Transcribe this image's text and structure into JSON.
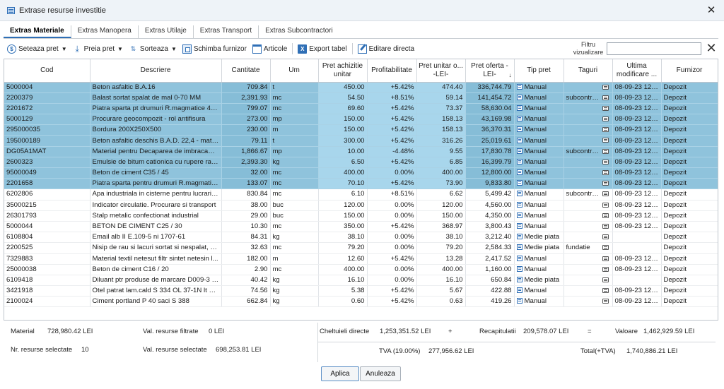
{
  "window": {
    "title": "Extrase resurse investitie",
    "close_glyph": "✕"
  },
  "tabs": [
    {
      "label": "Extras Materiale",
      "active": true
    },
    {
      "label": "Extras Manopera",
      "active": false
    },
    {
      "label": "Extras Utilaje",
      "active": false
    },
    {
      "label": "Extras Transport",
      "active": false
    },
    {
      "label": "Extras Subcontractori",
      "active": false
    }
  ],
  "toolbar": {
    "seteaza_pret": "Seteaza pret",
    "preia_pret": "Preia pret",
    "sorteaza": "Sorteaza",
    "schimba_furnizor": "Schimba furnizor",
    "articole": "Articole",
    "export_tabel": "Export tabel",
    "editare_directa": "Editare directa",
    "caret": "▼"
  },
  "filter": {
    "label": "Filtru vizualizare",
    "value": "",
    "clear_glyph": "✕"
  },
  "columns": [
    "Cod",
    "Descriere",
    "Cantitate",
    "Um",
    "Pret achizitie unitar",
    "Profitabilitate",
    "Pret unitar o... -LEI-",
    "Pret oferta -LEI-",
    "Tip pret",
    "Taguri",
    "Ultima modificare ...",
    "Furnizor"
  ],
  "rows": [
    {
      "cod": "5000004",
      "descriere": "Beton asfaltic B.A.16",
      "cantitate": "709.84",
      "um": "t",
      "pret_achizitie": "450.00",
      "profit": "+5.42%",
      "pret_unitar": "474.40",
      "pret_oferta": "336,744.79",
      "tip": "Manual",
      "taguri": "",
      "note": true,
      "modificare": "08-09-23 12:4...",
      "furnizor": "Depozit",
      "selected": true
    },
    {
      "cod": "2200379",
      "descriere": "Balast sortat spalat de mal 0-70 MM",
      "cantitate": "2,391.93",
      "um": "mc",
      "pret_achizitie": "54.50",
      "profit": "+8.51%",
      "pret_unitar": "59.14",
      "pret_oferta": "141,454.72",
      "tip": "Manual",
      "taguri": "subcontrac...",
      "note": true,
      "modificare": "08-09-23 12:4...",
      "furnizor": "Depozit",
      "selected": true
    },
    {
      "cod": "2201672",
      "descriere": "Piatra sparta pt drumuri R.magmatice 40-...",
      "cantitate": "799.07",
      "um": "mc",
      "pret_achizitie": "69.60",
      "profit": "+5.42%",
      "pret_unitar": "73.37",
      "pret_oferta": "58,630.04",
      "tip": "Manual",
      "taguri": "",
      "note": true,
      "modificare": "08-09-23 12:4...",
      "furnizor": "Depozit",
      "selected": true
    },
    {
      "cod": "5000129",
      "descriere": "Procurare geocompozit - rol antifisura",
      "cantitate": "273.00",
      "um": "mp",
      "pret_achizitie": "150.00",
      "profit": "+5.42%",
      "pret_unitar": "158.13",
      "pret_oferta": "43,169.98",
      "tip": "Manual",
      "taguri": "",
      "note": true,
      "modificare": "08-09-23 12:4...",
      "furnizor": "Depozit",
      "selected": true
    },
    {
      "cod": "295000035",
      "descriere": "Bordura 200X250X500",
      "cantitate": "230.00",
      "um": "m",
      "pret_achizitie": "150.00",
      "profit": "+5.42%",
      "pret_unitar": "158.13",
      "pret_oferta": "36,370.31",
      "tip": "Manual",
      "taguri": "",
      "note": true,
      "modificare": "08-09-23 12:4...",
      "furnizor": "Depozit",
      "selected": true
    },
    {
      "cod": "195000189",
      "descriere": "Beton asfaltic deschis B.A.D. 22,4 - material",
      "cantitate": "79.11",
      "um": "t",
      "pret_achizitie": "300.00",
      "profit": "+5.42%",
      "pret_unitar": "316.26",
      "pret_oferta": "25,019.61",
      "tip": "Manual",
      "taguri": "",
      "note": true,
      "modificare": "08-09-23 12:4...",
      "furnizor": "Depozit",
      "selected": true
    },
    {
      "cod": "DG05A1MAT",
      "descriere": "Material pentru Decaparea de imbracami...",
      "cantitate": "1,866.67",
      "um": "mp",
      "pret_achizitie": "10.00",
      "profit": "-4.48%",
      "pret_unitar": "9.55",
      "pret_oferta": "17,830.78",
      "tip": "Manual",
      "taguri": "subcontrac...",
      "note": true,
      "modificare": "08-09-23 12:4...",
      "furnizor": "Depozit",
      "selected": true
    },
    {
      "cod": "2600323",
      "descriere": "Emulsie de bitum cationica cu rupere rapi...",
      "cantitate": "2,393.30",
      "um": "kg",
      "pret_achizitie": "6.50",
      "profit": "+5.42%",
      "pret_unitar": "6.85",
      "pret_oferta": "16,399.79",
      "tip": "Manual",
      "taguri": "",
      "note": true,
      "modificare": "08-09-23 12:4...",
      "furnizor": "Depozit",
      "selected": true
    },
    {
      "cod": "95000049",
      "descriere": "Beton de ciment C35 / 45",
      "cantitate": "32.00",
      "um": "mc",
      "pret_achizitie": "400.00",
      "profit": "0.00%",
      "pret_unitar": "400.00",
      "pret_oferta": "12,800.00",
      "tip": "Manual",
      "taguri": "",
      "note": true,
      "modificare": "08-09-23 12:4...",
      "furnizor": "Depozit",
      "selected": true
    },
    {
      "cod": "2201658",
      "descriere": "Piatra sparta pentru drumuri R.magmatic...",
      "cantitate": "133.07",
      "um": "mc",
      "pret_achizitie": "70.10",
      "profit": "+5.42%",
      "pret_unitar": "73.90",
      "pret_oferta": "9,833.80",
      "tip": "Manual",
      "taguri": "",
      "note": true,
      "modificare": "08-09-23 12:4...",
      "furnizor": "Depozit",
      "selected": true
    },
    {
      "cod": "6202806",
      "descriere": "Apa industriala in cisterne pentru lucrari d...",
      "cantitate": "830.84",
      "um": "mc",
      "pret_achizitie": "6.10",
      "profit": "+8.51%",
      "pret_unitar": "6.62",
      "pret_oferta": "5,499.42",
      "tip": "Manual",
      "taguri": "subcontrac...",
      "note": true,
      "modificare": "08-09-23 12:4...",
      "furnizor": "Depozit",
      "selected": false
    },
    {
      "cod": "35000215",
      "descriere": "Indicator circulatie. Procurare si transport",
      "cantitate": "38.00",
      "um": "buc",
      "pret_achizitie": "120.00",
      "profit": "0.00%",
      "pret_unitar": "120.00",
      "pret_oferta": "4,560.00",
      "tip": "Manual",
      "taguri": "",
      "note": true,
      "modificare": "08-09-23 12:4...",
      "furnizor": "Depozit",
      "selected": false
    },
    {
      "cod": "26301793",
      "descriere": "Stalp metalic confectionat industrial",
      "cantitate": "29.00",
      "um": "buc",
      "pret_achizitie": "150.00",
      "profit": "0.00%",
      "pret_unitar": "150.00",
      "pret_oferta": "4,350.00",
      "tip": "Manual",
      "taguri": "",
      "note": true,
      "modificare": "08-09-23 12:4...",
      "furnizor": "Depozit",
      "selected": false
    },
    {
      "cod": "5000044",
      "descriere": "BETON DE CIMENT C25 / 30",
      "cantitate": "10.30",
      "um": "mc",
      "pret_achizitie": "350.00",
      "profit": "+5.42%",
      "pret_unitar": "368.97",
      "pret_oferta": "3,800.43",
      "tip": "Manual",
      "taguri": "",
      "note": true,
      "modificare": "08-09-23 12:4...",
      "furnizor": "Depozit",
      "selected": false
    },
    {
      "cod": "6108804",
      "descriere": "Email alb II E.109-5 ni 1707-61",
      "cantitate": "84.31",
      "um": "kg",
      "pret_achizitie": "38.10",
      "profit": "0.00%",
      "pret_unitar": "38.10",
      "pret_oferta": "3,212.40",
      "tip": "Medie piata",
      "taguri": "",
      "note": true,
      "modificare": "",
      "furnizor": "Depozit",
      "selected": false
    },
    {
      "cod": "2200525",
      "descriere": "Nisip de rau si lacuri sortat si nespalat, 0.0...",
      "cantitate": "32.63",
      "um": "mc",
      "pret_achizitie": "79.20",
      "profit": "0.00%",
      "pret_unitar": "79.20",
      "pret_oferta": "2,584.33",
      "tip": "Medie piata",
      "taguri": "fundatie",
      "note": true,
      "modificare": "",
      "furnizor": "Depozit",
      "selected": false
    },
    {
      "cod": "7329883",
      "descriere": "Material textil netesut filtr sintet netesin l...",
      "cantitate": "182.00",
      "um": "m",
      "pret_achizitie": "12.60",
      "profit": "+5.42%",
      "pret_unitar": "13.28",
      "pret_oferta": "2,417.52",
      "tip": "Manual",
      "taguri": "",
      "note": true,
      "modificare": "08-09-23 12:4...",
      "furnizor": "Depozit",
      "selected": false
    },
    {
      "cod": "25000038",
      "descriere": "Beton de ciment C16 / 20",
      "cantitate": "2.90",
      "um": "mc",
      "pret_achizitie": "400.00",
      "profit": "0.00%",
      "pret_unitar": "400.00",
      "pret_oferta": "1,160.00",
      "tip": "Manual",
      "taguri": "",
      "note": true,
      "modificare": "08-09-23 12:4...",
      "furnizor": "Depozit",
      "selected": false
    },
    {
      "cod": "6109418",
      "descriere": "Diluant ptr produse de marcare D009-3 n...",
      "cantitate": "40.42",
      "um": "kg",
      "pret_achizitie": "16.10",
      "profit": "0.00%",
      "pret_unitar": "16.10",
      "pret_oferta": "650.84",
      "tip": "Medie piata",
      "taguri": "",
      "note": true,
      "modificare": "",
      "furnizor": "Depozit",
      "selected": false
    },
    {
      "cod": "3421918",
      "descriere": "Otel patrat lam.cald S 334 OL 37-1N lt = ...",
      "cantitate": "74.56",
      "um": "kg",
      "pret_achizitie": "5.38",
      "profit": "+5.42%",
      "pret_unitar": "5.67",
      "pret_oferta": "422.88",
      "tip": "Manual",
      "taguri": "",
      "note": true,
      "modificare": "08-09-23 12:4...",
      "furnizor": "Depozit",
      "selected": false
    },
    {
      "cod": "2100024",
      "descriere": "Ciment portland P 40 saci S 388",
      "cantitate": "662.84",
      "um": "kg",
      "pret_achizitie": "0.60",
      "profit": "+5.42%",
      "pret_unitar": "0.63",
      "pret_oferta": "419.26",
      "tip": "Manual",
      "taguri": "",
      "note": true,
      "modificare": "08-09-23 12:4...",
      "furnizor": "Depozit",
      "selected": false
    }
  ],
  "summary": {
    "material_label": "Material",
    "material_value": "728,980.42 LEI",
    "filtrate_label": "Val. resurse filtrate",
    "filtrate_value": "0 LEI",
    "nr_label": "Nr. resurse selectate",
    "nr_value": "10",
    "selectate_label": "Val. resurse selectate",
    "selectate_value": "698,253.81 LEI",
    "directe_label": "Cheltuieli directe",
    "directe_value": "1,253,351.52 LEI",
    "plus": "+",
    "recap_label": "Recapitulatii",
    "recap_value": "209,578.07 LEI",
    "equals": "=",
    "valoare_label": "Valoare",
    "valoare_value": "1,462,929.59 LEI",
    "tva_label": "TVA (19.00%)",
    "tva_value": "277,956.62 LEI",
    "total_label": "Total(+TVA)",
    "total_value": "1,740,886.21 LEI"
  },
  "buttons": {
    "ok": "Aplica",
    "cancel": "Anuleaza"
  }
}
